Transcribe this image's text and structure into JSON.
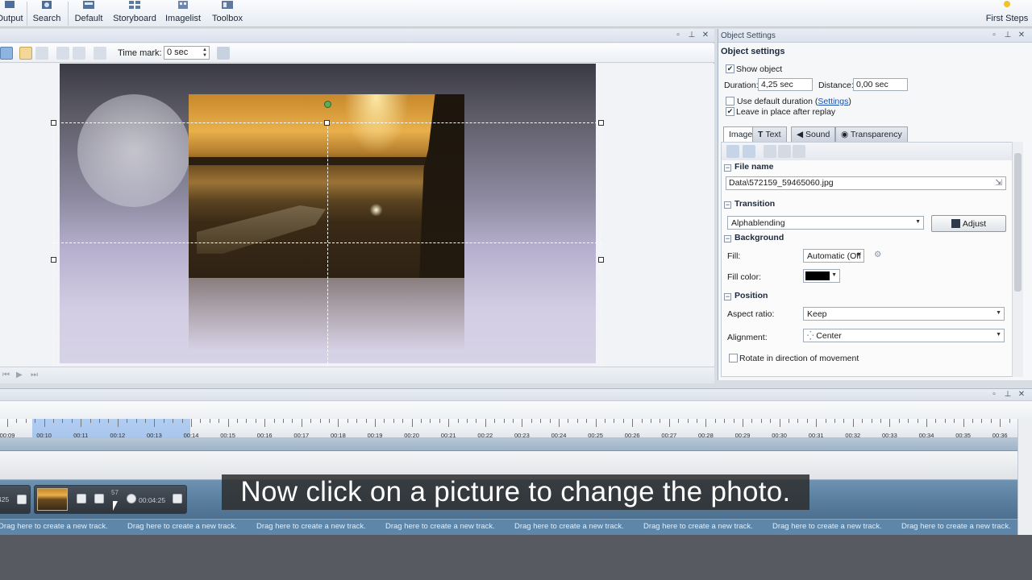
{
  "ribbon": {
    "items": [
      {
        "label": "Output"
      },
      {
        "label": "Search"
      },
      {
        "label": "Default"
      },
      {
        "label": "Storyboard"
      },
      {
        "label": "Imagelist"
      },
      {
        "label": "Toolbox"
      }
    ],
    "first_steps": "First Steps"
  },
  "preview": {
    "time_mark_label": "Time mark:",
    "time_mark_value": "0 sec"
  },
  "settings": {
    "window_title": "Object Settings",
    "heading": "Object settings",
    "show_object": "Show object",
    "duration_label": "Duration:",
    "duration_value": "4,25 sec",
    "distance_label": "Distance:",
    "distance_value": "0,00 sec",
    "use_default_duration": "Use default duration",
    "settings_link": "Settings",
    "leave_in_place": "Leave in place after replay",
    "tabs": [
      {
        "label": "Image"
      },
      {
        "label": "Text"
      },
      {
        "label": "Sound"
      },
      {
        "label": "Transparency"
      }
    ],
    "file_name_head": "File name",
    "file_name_value": "Data\\572159_59465060.jpg",
    "transition_head": "Transition",
    "transition_value": "Alphablending",
    "adjust_label": "Adjust",
    "background_head": "Background",
    "fill_label": "Fill:",
    "fill_value": "Automatic (Off",
    "fill_color_label": "Fill color:",
    "fill_color_hex": "#000000",
    "position_head": "Position",
    "aspect_label": "Aspect ratio:",
    "aspect_value": "Keep",
    "alignment_label": "Alignment:",
    "alignment_value": "Center",
    "rotate_label": "Rotate in direction of movement"
  },
  "timeline": {
    "ticks": [
      "00:09",
      "00:10",
      "00:11",
      "00:12",
      "00:13",
      "00:14",
      "00:15",
      "00:16",
      "00:17",
      "00:18",
      "00:19",
      "00:20",
      "00:21",
      "00:22",
      "00:23",
      "00:24",
      "00:25",
      "00:26",
      "00:27",
      "00:28",
      "00:29",
      "00:30",
      "00:31",
      "00:32",
      "00:33",
      "00:34",
      "00:35",
      "00:36"
    ],
    "clip_prev_time": "425",
    "clip_number": "57",
    "clip_time": "00:04:25",
    "drag_hint": "Drag here to create a new track."
  },
  "subtitle": "Now click on a picture to change the photo."
}
